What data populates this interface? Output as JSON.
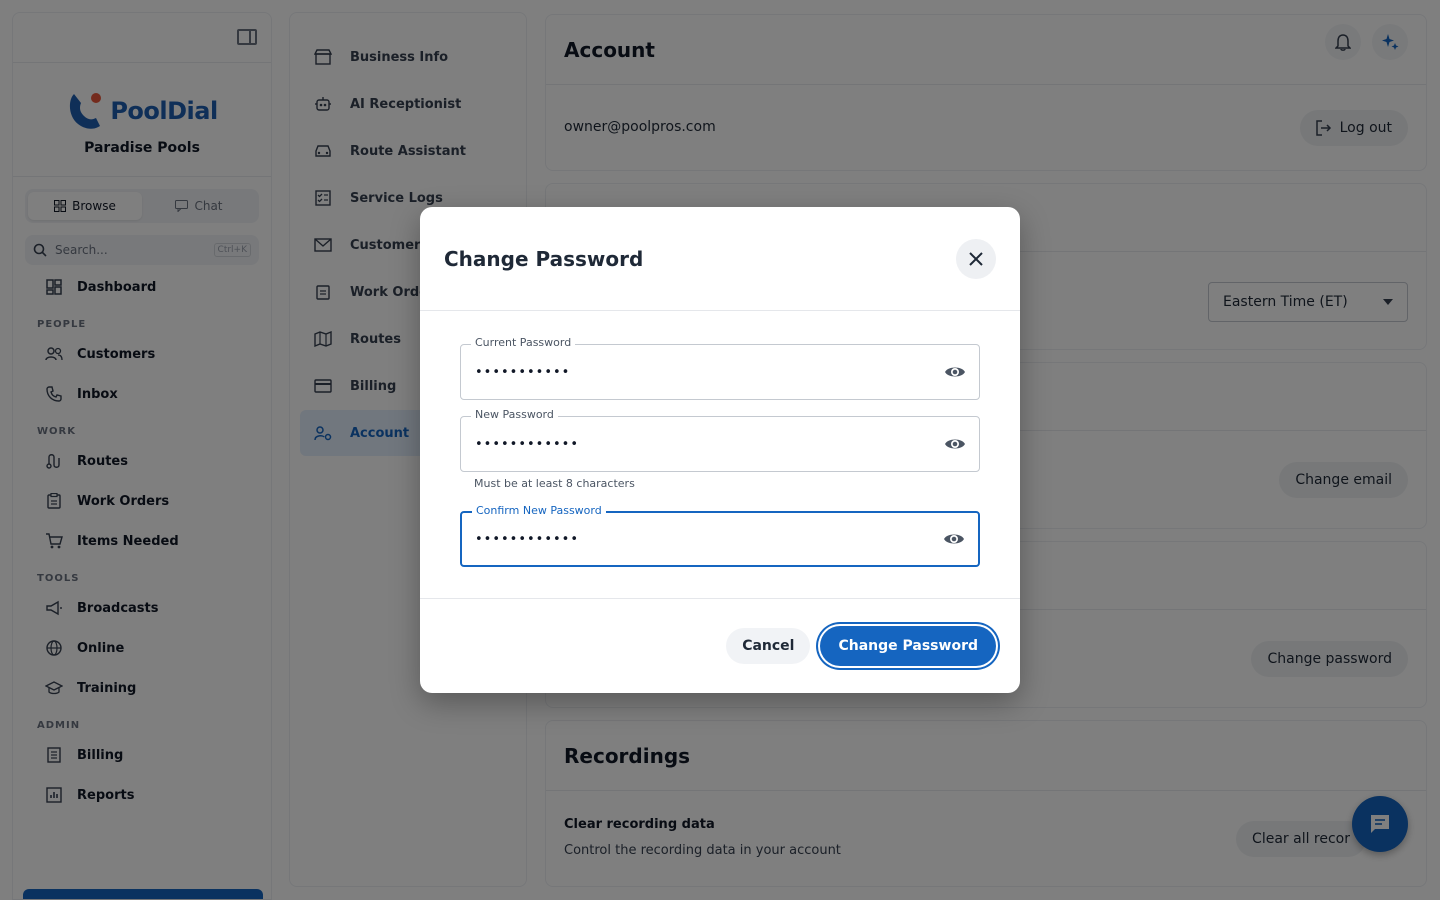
{
  "brand": {
    "logo_text": "PoolDial",
    "business_name": "Paradise Pools"
  },
  "sidebar": {
    "segments": [
      {
        "label": "Browse"
      },
      {
        "label": "Chat"
      }
    ],
    "search": {
      "placeholder": "Search...",
      "shortcut": "Ctrl+K"
    },
    "dashboard": "Dashboard",
    "sections": {
      "people": {
        "title": "PEOPLE",
        "items": [
          "Customers",
          "Inbox"
        ]
      },
      "work": {
        "title": "WORK",
        "items": [
          "Routes",
          "Work Orders",
          "Items Needed"
        ]
      },
      "tools": {
        "title": "TOOLS",
        "items": [
          "Broadcasts",
          "Online",
          "Training"
        ]
      },
      "admin": {
        "title": "ADMIN",
        "items": [
          "Billing",
          "Reports"
        ]
      }
    }
  },
  "settings_nav": [
    "Business Info",
    "AI Receptionist",
    "Route Assistant",
    "Service Logs",
    "Customer",
    "Work Orde",
    "Routes",
    "Billing",
    "Account"
  ],
  "main": {
    "account": {
      "title": "Account",
      "email": "owner@poolpros.com",
      "logout": "Log out"
    },
    "timezone": "Eastern Time (ET)",
    "change_email": "Change email",
    "change_password": "Change password",
    "recordings": {
      "title": "Recordings",
      "item_title": "Clear recording data",
      "item_desc": "Control the recording data in your account",
      "button": "Clear all recor"
    }
  },
  "modal": {
    "title": "Change Password",
    "fields": {
      "current": {
        "label": "Current Password",
        "value": "•••••••••••"
      },
      "new": {
        "label": "New Password",
        "value": "••••••••••••",
        "helper": "Must be at least 8 characters"
      },
      "confirm": {
        "label": "Confirm New Password",
        "value": "••••••••••••"
      }
    },
    "cancel": "Cancel",
    "submit": "Change Password"
  },
  "colors": {
    "primary": "#1565c0",
    "overlay": "rgba(0,0,0,0.5)"
  }
}
